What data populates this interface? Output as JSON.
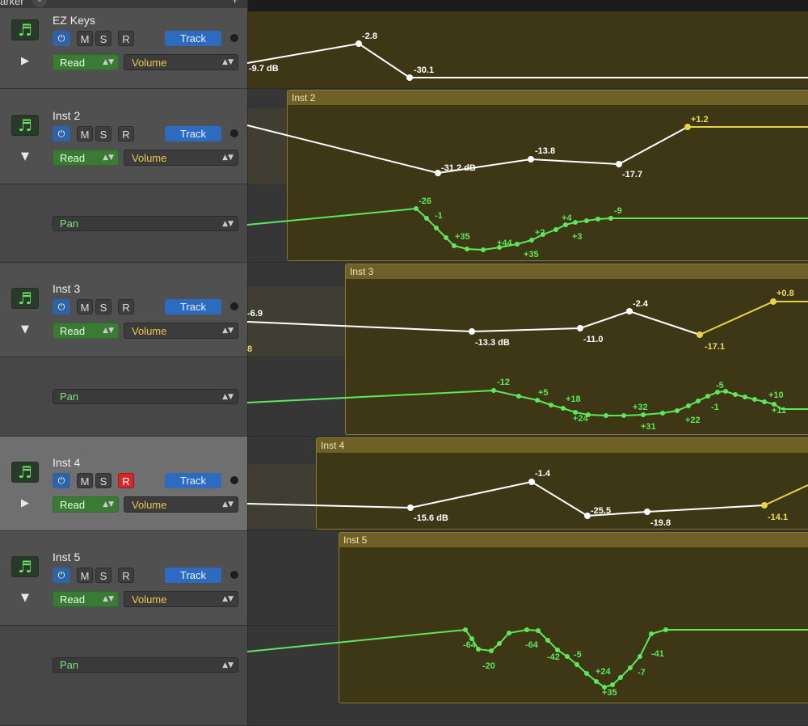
{
  "header": {
    "marker_label": "arker",
    "add_label": "+"
  },
  "tracks": [
    {
      "name": "EZ Keys",
      "mode": "Read",
      "param": "Volume",
      "track_label": "Track"
    },
    {
      "name": "Inst 2",
      "mode": "Read",
      "param": "Volume",
      "track_label": "Track",
      "lane_param": "Pan"
    },
    {
      "name": "Inst 3",
      "mode": "Read",
      "param": "Volume",
      "track_label": "Track",
      "lane_param": "Pan"
    },
    {
      "name": "Inst 4",
      "mode": "Read",
      "param": "Volume",
      "track_label": "Track"
    },
    {
      "name": "Inst 5",
      "mode": "Read",
      "param": "Volume",
      "track_label": "Track",
      "lane_param": "Pan"
    }
  ],
  "buttons": {
    "mute": "M",
    "solo": "S",
    "record": "R"
  },
  "regions": [
    "Inst 2",
    "Inst 3",
    "Inst 4",
    "Inst 5"
  ],
  "labels": {
    "ezkeys": [
      "-9.7 dB",
      "-2.8",
      "-30.1"
    ],
    "inst2_vol": [
      "-31.2 dB",
      "-13.8",
      "-17.7",
      "+1.2"
    ],
    "inst2_pan": [
      "-26",
      "-1",
      "+35",
      "+44",
      "+35",
      "+2",
      "+4",
      "+3",
      "-9"
    ],
    "inst3_vol": [
      "-6.9",
      "8",
      "-13.3 dB",
      "-11.0",
      "-2.4",
      "-17.1",
      "+0.8"
    ],
    "inst3_pan": [
      "-12",
      "+5",
      "+18",
      "+24",
      "+32",
      "+31",
      "+22",
      "-1",
      "-5",
      "+10",
      "+11"
    ],
    "inst4_vol": [
      "-15.6 dB",
      "-1.4",
      "-25.5",
      "-19.8",
      "-14.1"
    ],
    "inst5_pan": [
      "-64",
      "-20",
      "-64",
      "-42",
      "-5",
      "+24",
      "+35",
      "-7",
      "-41"
    ]
  },
  "colors": {
    "volume_line": "#ffffff",
    "pan_line": "#5de85a",
    "region_header": "#6e6026",
    "record_on": "#d02a2a"
  }
}
